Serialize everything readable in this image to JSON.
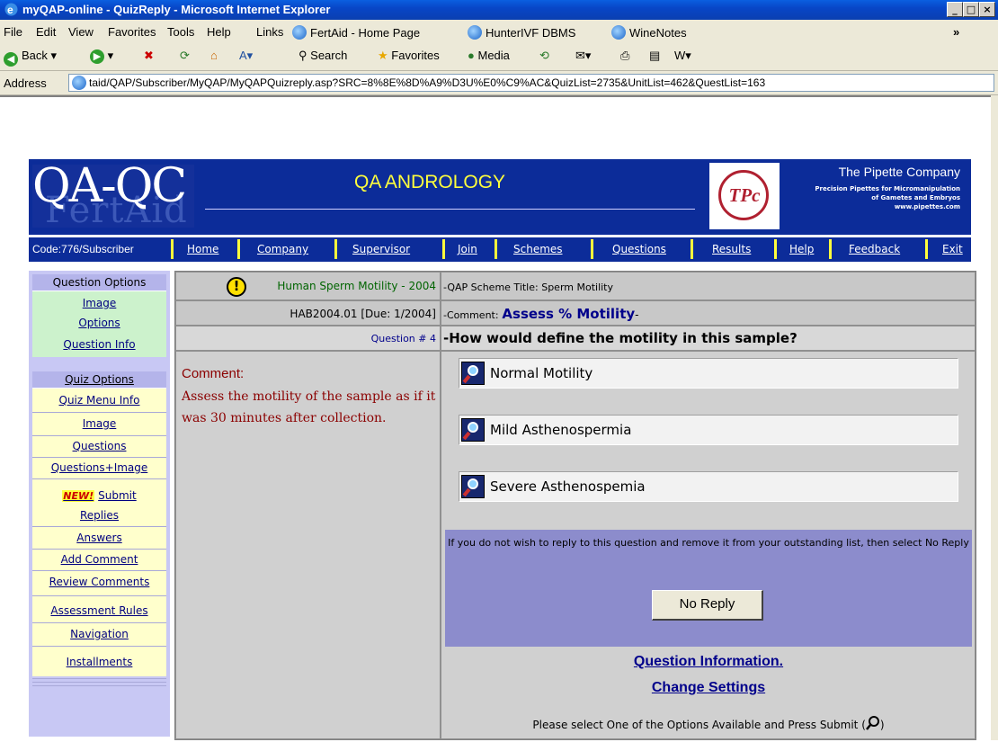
{
  "window": {
    "title": "myQAP-online - QuizReply - Microsoft Internet Explorer",
    "controls": [
      "_",
      "□",
      "×"
    ]
  },
  "menu": {
    "items": [
      "File",
      "Edit",
      "View",
      "Favorites",
      "Tools",
      "Help"
    ],
    "links_label": "Links",
    "links": [
      "FertAid - Home Page",
      "HunterIVF DBMS",
      "WineNotes"
    ],
    "overflow": "»"
  },
  "toolbar": {
    "back": "Back",
    "search": "Search",
    "favorites": "Favorites",
    "media": "Media"
  },
  "address": {
    "label": "Address",
    "url": "taid/QAP/Subscriber/MyQAP/MyQAPQuizreply.asp?SRC=8%8E%8D%A9%D3U%E0%C9%AC&QuizList=2735&UnitList=462&QuestList=163"
  },
  "banner": {
    "logo_main": "QA-QC",
    "logo_sub": "FertAid",
    "title": "QA ANDROLOGY",
    "tpc_logo": "TPc",
    "company": "The Pipette Company",
    "company_desc_1": "Precision Pipettes for Micromanipulation",
    "company_desc_2": "of Gametes and Embryos",
    "company_url": "www.pipettes.com"
  },
  "nav": {
    "code": "Code:776/Subscriber",
    "links": [
      "Home",
      "Company",
      "Supervisor",
      "Join",
      "Schemes",
      "Questions",
      "Results",
      "Help",
      "Feedback",
      "Exit"
    ]
  },
  "sidebar": {
    "question_options_header": "Question Options",
    "question_options": [
      "Image",
      "Options",
      "Question Info"
    ],
    "quiz_options_header": "Quiz Options",
    "quiz_options": [
      "Quiz Menu Info",
      "Image",
      "Questions",
      "Questions+Image"
    ],
    "new_badge": "NEW!",
    "submit_label": "Submit",
    "replies_label": "Replies",
    "more_options": [
      "Answers",
      "Add Comment",
      "Review Comments",
      "Assessment Rules",
      "Navigation",
      "Installments"
    ]
  },
  "question": {
    "scheme_link": "Human Sperm Motility - 2004",
    "scheme_title": "-QAP Scheme Title: Sperm Motility",
    "code": "HAB2004.01 [Due: 1/2004]",
    "comment_prefix": "-Comment:",
    "comment_title": "Assess % Motility",
    "comment_suffix": "-",
    "number": "Question # 4",
    "text": "-How would define the motility in this sample?",
    "comment_label": "Comment:",
    "comment_body": "Assess the motility of the sample as if it was 30 minutes after collection.",
    "options": [
      "Normal Motility",
      "Mild Asthenospermia",
      "Severe Asthenospemia"
    ],
    "no_reply_message": "If you do not wish to reply to this question and remove it from your outstanding list, then select No Reply",
    "no_reply_button": "No Reply",
    "info_link": "Question Information.",
    "settings_link": "Change Settings",
    "instruction": "Please select One of the Options Available and Press Submit (",
    "instruction_end": ")"
  }
}
